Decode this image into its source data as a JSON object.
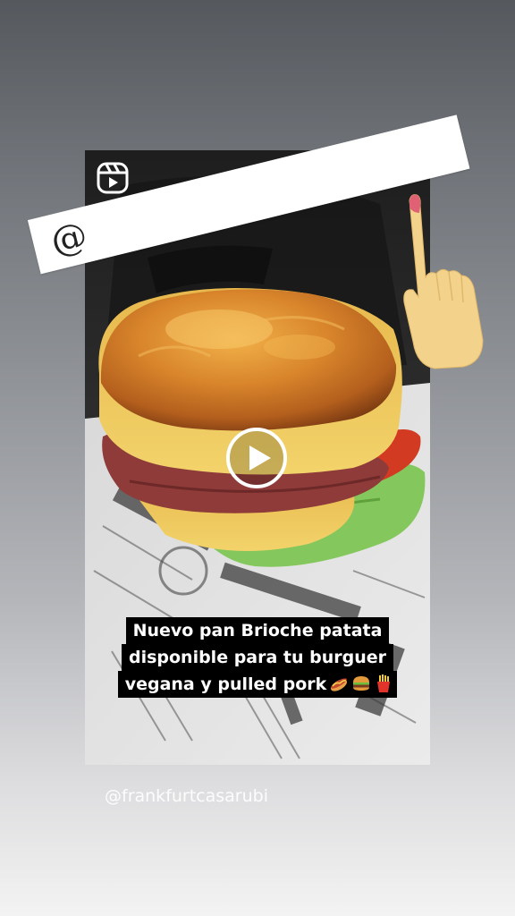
{
  "mention_sticker": {
    "at_symbol": "@",
    "background": "#ffffff"
  },
  "post": {
    "reels_icon": "reels-icon",
    "play_icon": "play-icon",
    "caption_lines": [
      "Nuevo pan Brioche patata",
      "disponible para tu burguer",
      "vegana y pulled pork"
    ],
    "caption_emojis": [
      "hotdog-emoji",
      "burger-emoji",
      "fries-emoji"
    ],
    "caption_background": "#000000"
  },
  "pointing_hand": "pointing-hand-emoji",
  "username": "@frankfurtcasarubi"
}
